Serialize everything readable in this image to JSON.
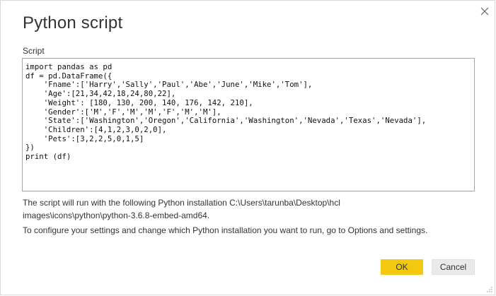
{
  "dialog": {
    "title": "Python script",
    "close_icon": "close-icon"
  },
  "script": {
    "label": "Script",
    "code": "import pandas as pd\ndf = pd.DataFrame({\n    'Fname':['Harry','Sally','Paul','Abe','June','Mike','Tom'],\n    'Age':[21,34,42,18,24,80,22],\n    'Weight': [180, 130, 200, 140, 176, 142, 210],\n    'Gender':['M','F','M','M','F','M','M'],\n    'State':['Washington','Oregon','California','Washington','Nevada','Texas','Nevada'],\n    'Children':[4,1,2,3,0,2,0],\n    'Pets':[3,2,2,5,0,1,5]\n})\nprint (df)"
  },
  "info": {
    "line1": "The script will run with the following Python installation C:\\Users\\tarunba\\Desktop\\hcl",
    "line2": "images\\icons\\python\\python-3.6.8-embed-amd64.",
    "line3": "To configure your settings and change which Python installation you want to run, go to Options and settings."
  },
  "buttons": {
    "ok_label": "OK",
    "cancel_label": "Cancel"
  },
  "colors": {
    "accent": "#f2c811",
    "secondary_button": "#eaeaea"
  }
}
